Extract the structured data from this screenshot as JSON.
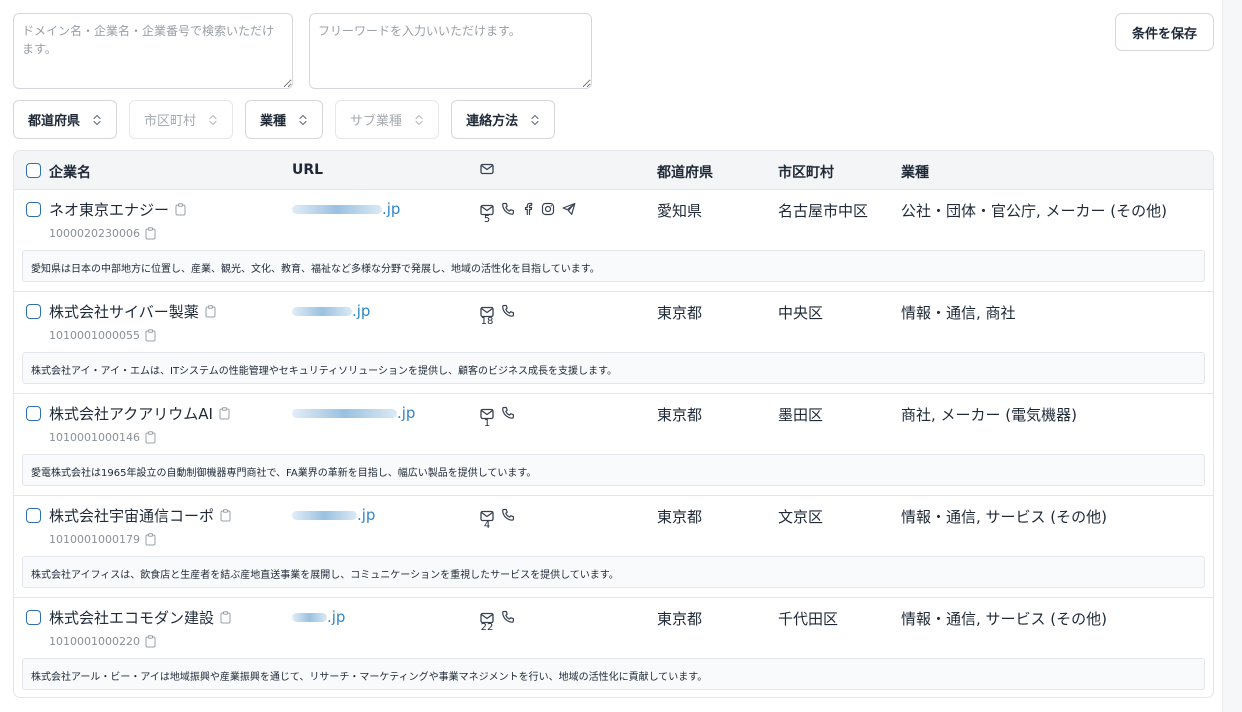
{
  "search": {
    "domain_placeholder": "ドメイン名・企業名・企業番号で検索いただけます。",
    "free_placeholder": "フリーワードを入力いいただけます。"
  },
  "save_label": "条件を保存",
  "filters": [
    {
      "label": "都道府県",
      "enabled": true
    },
    {
      "label": "市区町村",
      "enabled": false
    },
    {
      "label": "業種",
      "enabled": true
    },
    {
      "label": "サブ業種",
      "enabled": false
    },
    {
      "label": "連絡方法",
      "enabled": true
    }
  ],
  "columns": {
    "company": "企業名",
    "url": "URL",
    "contact_icon": "mail-icon",
    "prefecture": "都道府県",
    "city": "市区町村",
    "industry": "業種"
  },
  "rows": [
    {
      "name": "ネオ東京エナジー",
      "corp_no": "1000020230006",
      "url_tld": ".jp",
      "mail_count": "5",
      "contacts": [
        "mail-icon",
        "phone-icon",
        "facebook-icon",
        "instagram-icon",
        "telegram-icon"
      ],
      "prefecture": "愛知県",
      "city": "名古屋市中区",
      "industry": "公社・団体・官公庁, メーカー (その他)",
      "description": "愛知県は日本の中部地方に位置し、産業、観光、文化、教育、福祉など多様な分野で発展し、地域の活性化を目指しています。"
    },
    {
      "name": "株式会社サイバー製薬",
      "corp_no": "1010001000055",
      "url_tld": ".jp",
      "mail_count": "18",
      "contacts": [
        "mail-icon",
        "phone-icon"
      ],
      "prefecture": "東京都",
      "city": "中央区",
      "industry": "情報・通信, 商社",
      "description": "株式会社アイ・アイ・エムは、ITシステムの性能管理やセキュリティソリューションを提供し、顧客のビジネス成長を支援します。"
    },
    {
      "name": "株式会社アクアリウムAI",
      "corp_no": "1010001000146",
      "url_tld": ".jp",
      "mail_count": "1",
      "contacts": [
        "mail-icon",
        "phone-icon"
      ],
      "prefecture": "東京都",
      "city": "墨田区",
      "industry": "商社, メーカー (電気機器)",
      "description": "愛電株式会社は1965年設立の自動制御機器専門商社で、FA業界の革新を目指し、幅広い製品を提供しています。"
    },
    {
      "name": "株式会社宇宙通信コーポ",
      "corp_no": "1010001000179",
      "url_tld": ".jp",
      "mail_count": "4",
      "contacts": [
        "mail-icon",
        "phone-icon"
      ],
      "prefecture": "東京都",
      "city": "文京区",
      "industry": "情報・通信, サービス (その他)",
      "description": "株式会社アイフィスは、飲食店と生産者を結ぶ産地直送事業を展開し、コミュニケーションを重視したサービスを提供しています。"
    },
    {
      "name": "株式会社エコモダン建設",
      "corp_no": "1010001000220",
      "url_tld": ".jp",
      "mail_count": "22",
      "contacts": [
        "mail-icon",
        "phone-icon"
      ],
      "prefecture": "東京都",
      "city": "千代田区",
      "industry": "情報・通信, サービス (その他)",
      "description": "株式会社アール・ビー・アイは地域振興や産業振興を通じて、リサーチ・マーケティングや事業マネジメントを行い、地域の活性化に貢献しています。"
    }
  ]
}
